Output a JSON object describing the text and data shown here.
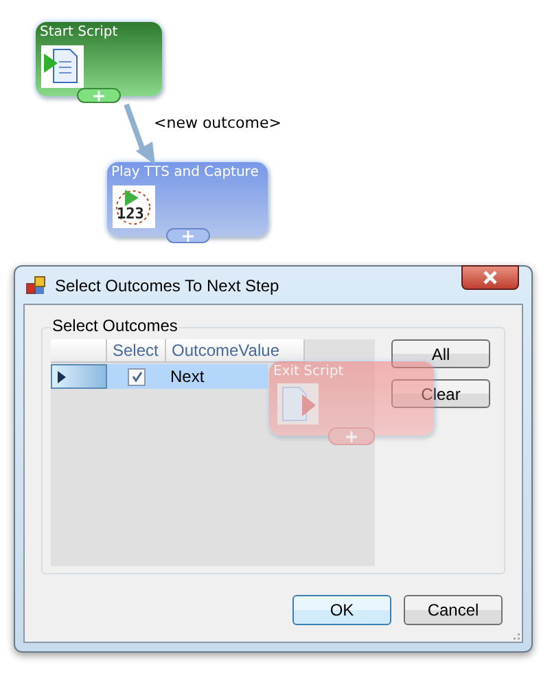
{
  "canvas": {
    "nodes": [
      {
        "title": "Start Script",
        "kind": "start"
      },
      {
        "title": "Play TTS and Capture",
        "kind": "tts",
        "icon_text": "123"
      }
    ],
    "connector": {
      "label": "<new outcome>"
    }
  },
  "ghost_node": {
    "title": "Exit Script",
    "kind": "exit"
  },
  "dialog": {
    "title": "Select Outcomes To Next Step",
    "group": {
      "label": "Select Outcomes"
    },
    "grid": {
      "columns": [
        "Select",
        "OutcomeValue"
      ],
      "rows": [
        {
          "selected": true,
          "checked": true,
          "value": "Next"
        }
      ]
    },
    "side_buttons": [
      "All",
      "Clear"
    ],
    "buttons": [
      {
        "label": "OK",
        "default": true
      },
      {
        "label": "Cancel",
        "default": false
      }
    ]
  }
}
